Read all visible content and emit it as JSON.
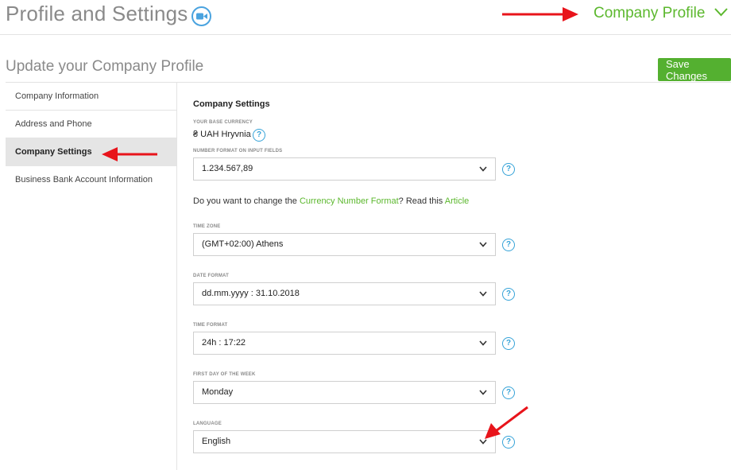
{
  "header": {
    "title": "Profile and Settings",
    "video_icon": "video-camera-icon",
    "company_profile_link": "Company Profile",
    "chevron_icon": "chevron-down-icon"
  },
  "subheader": {
    "title": "Update your Company Profile",
    "save_label": "Save Changes"
  },
  "sidebar": {
    "items": [
      {
        "label": "Company Information",
        "active": false
      },
      {
        "label": "Address and Phone",
        "active": false
      },
      {
        "label": "Company Settings",
        "active": true
      },
      {
        "label": "Business Bank Account Information",
        "active": false
      }
    ]
  },
  "settings": {
    "title": "Company Settings",
    "base_currency_label": "YOUR BASE CURRENCY",
    "base_currency_value": "₴ UAH Hryvnia",
    "number_format_label": "NUMBER FORMAT ON INPUT FIELDS",
    "number_format_value": "1.234.567,89",
    "question_prefix": "Do you want to change the ",
    "question_link": "Currency Number Format",
    "question_mid": "? Read this ",
    "question_article": "Article",
    "timezone_label": "TIME ZONE",
    "timezone_value": "(GMT+02:00) Athens",
    "date_format_label": "DATE FORMAT",
    "date_format_value": "dd.mm.yyyy : 31.10.2018",
    "time_format_label": "TIME FORMAT",
    "time_format_value": "24h : 17:22",
    "first_day_label": "FIRST DAY OF THE WEEK",
    "first_day_value": "Monday",
    "language_label": "LANGUAGE",
    "language_value": "English",
    "help_glyph": "?"
  },
  "colors": {
    "accent_green": "#5cb82e",
    "save_green": "#54b030",
    "help_blue": "#36a3d8",
    "annotation_red": "#e8141b"
  }
}
